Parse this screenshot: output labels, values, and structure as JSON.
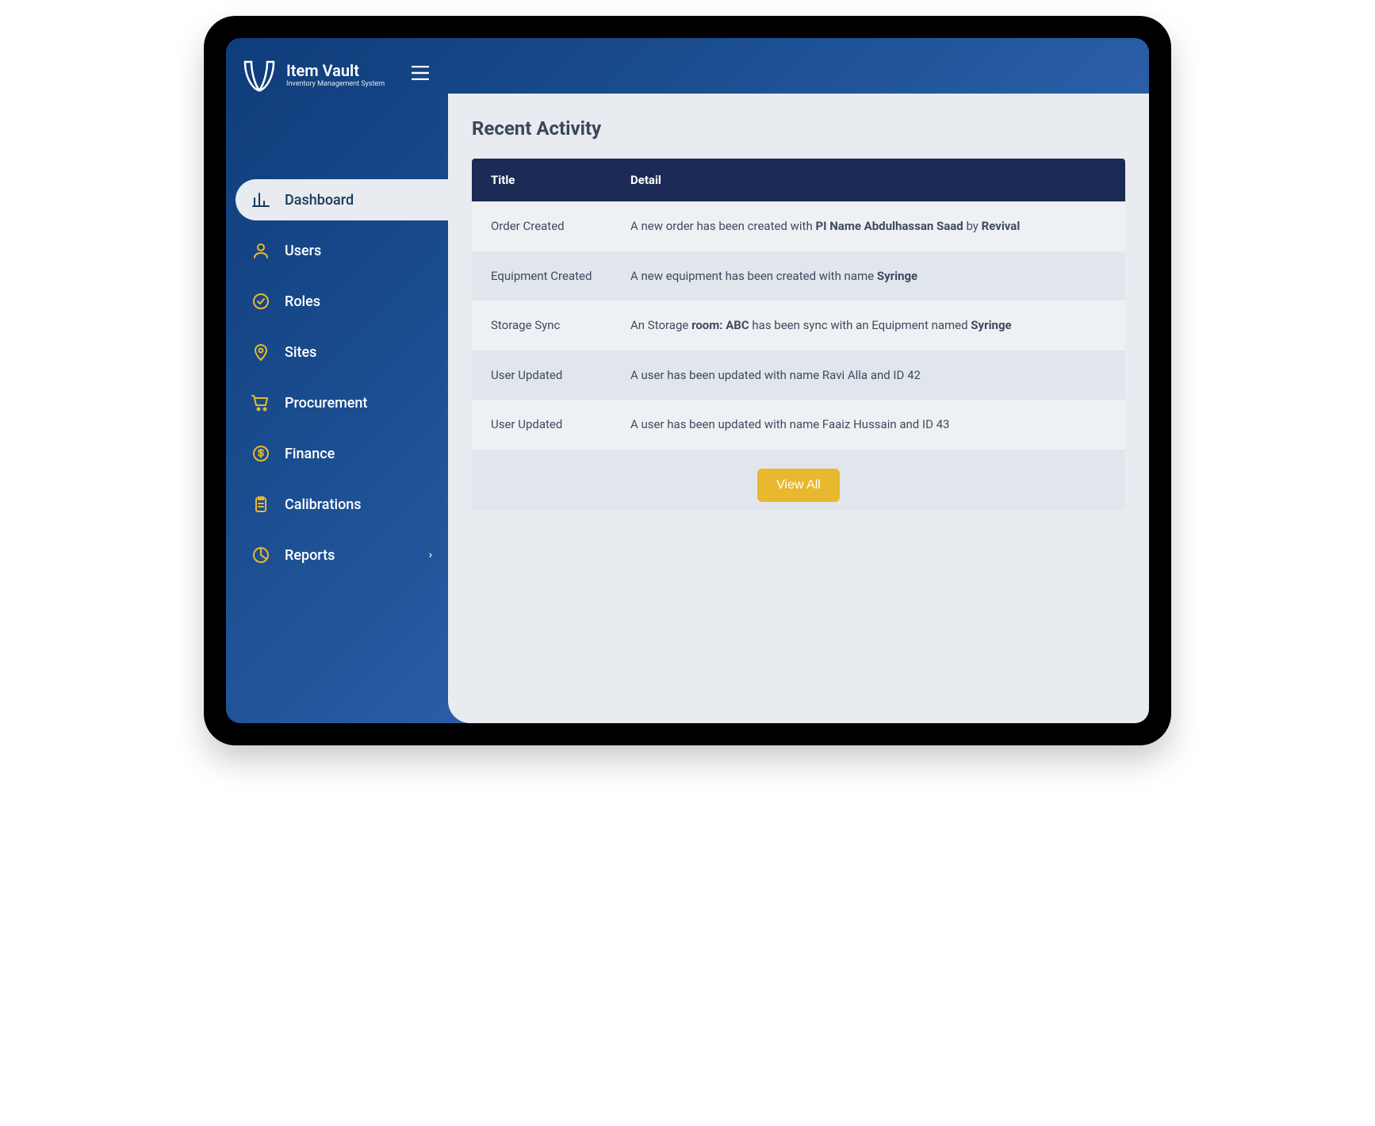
{
  "brand": {
    "title": "Item Vault",
    "subtitle": "Inventory Management System"
  },
  "sidebar": {
    "items": [
      {
        "icon": "chart-bar-icon",
        "label": "Dashboard",
        "active": true,
        "expandable": false
      },
      {
        "icon": "user-icon",
        "label": "Users",
        "active": false,
        "expandable": false
      },
      {
        "icon": "check-circle-icon",
        "label": "Roles",
        "active": false,
        "expandable": false
      },
      {
        "icon": "pin-icon",
        "label": "Sites",
        "active": false,
        "expandable": false
      },
      {
        "icon": "cart-icon",
        "label": "Procurement",
        "active": false,
        "expandable": false
      },
      {
        "icon": "dollar-icon",
        "label": "Finance",
        "active": false,
        "expandable": false
      },
      {
        "icon": "clipboard-icon",
        "label": "Calibrations",
        "active": false,
        "expandable": false
      },
      {
        "icon": "pie-icon",
        "label": "Reports",
        "active": false,
        "expandable": true
      }
    ]
  },
  "main": {
    "section_title": "Recent Activity",
    "columns": {
      "title": "Title",
      "detail": "Detail"
    },
    "rows": [
      {
        "title": "Order Created",
        "detail_html": "A new order has been created with <b>PI Name Abdulhassan Saad</b> by <b>Revival</b>"
      },
      {
        "title": "Equipment Created",
        "detail_html": "A new equipment has been created with name <b>Syringe</b>"
      },
      {
        "title": "Storage Sync",
        "detail_html": "An Storage <b>room: ABC</b> has been sync with an Equipment named <b>Syringe</b>"
      },
      {
        "title": "User Updated",
        "detail_html": "A user has been updated with name Ravi Alla and ID 42"
      },
      {
        "title": "User Updated",
        "detail_html": "A user has been updated with name Faaiz Hussain and ID 43"
      }
    ],
    "view_all_label": "View All"
  },
  "colors": {
    "accent": "#e8b82f",
    "header_dark": "#1b2b56",
    "bg_light": "#e8ebef"
  }
}
